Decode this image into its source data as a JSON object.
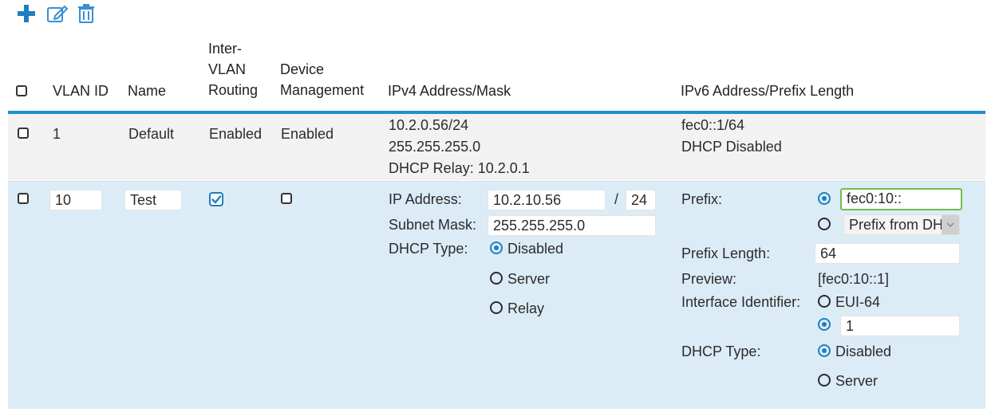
{
  "toolbar": {
    "add_icon": "plus-icon",
    "edit_icon": "pencil-edit-icon",
    "delete_icon": "trash-icon"
  },
  "table": {
    "headers": {
      "vlan_id": "VLAN ID",
      "name": "Name",
      "inter_vlan_line1": "Inter-",
      "inter_vlan_line2": "VLAN",
      "inter_vlan_line3": "Routing",
      "device_mgmt_line1": "Device",
      "device_mgmt_line2": "Management",
      "ipv4": "IPv4 Address/Mask",
      "ipv6": "IPv6 Address/Prefix Length"
    },
    "row1": {
      "vlan_id": "1",
      "name": "Default",
      "inter_vlan": "Enabled",
      "device_mgmt": "Enabled",
      "ipv4_line1": "10.2.0.56/24",
      "ipv4_line2": "255.255.255.0",
      "ipv4_line3": "DHCP Relay: 10.2.0.1",
      "ipv6_line1": "fec0::1/64",
      "ipv6_line2": "DHCP Disabled"
    },
    "row2": {
      "vlan_id": "10",
      "name": "Test",
      "inter_vlan_checked": true,
      "device_mgmt_checked": false,
      "ipv4": {
        "ip_label": "IP Address:",
        "ip_value": "10.2.10.56",
        "slash": "/",
        "prefix_value": "24",
        "mask_label": "Subnet Mask:",
        "mask_value": "255.255.255.0",
        "dhcp_label": "DHCP Type:",
        "dhcp_options": [
          "Disabled",
          "Server",
          "Relay"
        ],
        "dhcp_selected": "Disabled"
      },
      "ipv6": {
        "prefix_label": "Prefix:",
        "prefix_value": "fec0:10::",
        "prefix_dropdown": "Prefix from DHCP",
        "prefix_length_label": "Prefix Length:",
        "prefix_length_value": "64",
        "preview_label": "Preview:",
        "preview_value": "[fec0:10::1]",
        "iface_label": "Interface Identifier:",
        "iface_option_eui": "EUI-64",
        "iface_value": "1",
        "dhcp_label": "DHCP Type:",
        "dhcp_options": [
          "Disabled",
          "Server"
        ],
        "dhcp_selected": "Disabled"
      }
    }
  },
  "colors": {
    "accent": "#1f8fd0",
    "row_default_bg": "#f2f2f2",
    "row_edit_bg": "#dcecf6",
    "focus_border": "#6cc04a",
    "radio_on": "#1f7fc0"
  }
}
